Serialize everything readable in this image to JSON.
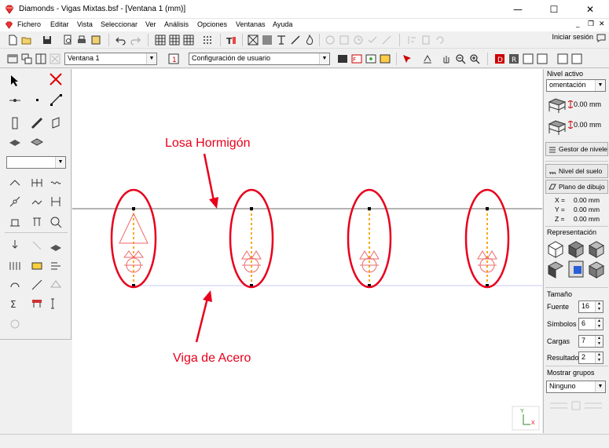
{
  "window": {
    "app_name": "Diamonds",
    "title_rest": "Vigas Mixtas.bsf - [Ventana 1  (mm)]",
    "minimize": "—",
    "maximize": "☐",
    "close": "✕"
  },
  "menu": {
    "items": [
      "Fichero",
      "Editar",
      "Vista",
      "Seleccionar",
      "Ver",
      "Análisis",
      "Opciones",
      "Ventanas",
      "Ayuda"
    ],
    "mdi_min": "_",
    "mdi_restore": "❐",
    "mdi_close": "✕"
  },
  "toolbar": {
    "login_label": "Iniciar sesión",
    "window_combo": "Ventana 1",
    "config_combo": "Configuración de usuario"
  },
  "right_panel": {
    "nivel_activo_label": "Nivel activo",
    "nivel_combo": "omentación",
    "level1_value": "0.00 mm",
    "level2_value": "0.00 mm",
    "gestor_button": "Gestor de niveles",
    "nivel_suelo_button": "Nivel del suelo",
    "plano_dibujo_button": "Plano de dibujo",
    "coords": [
      {
        "axis": "X =",
        "value": "0.00 mm"
      },
      {
        "axis": "Y =",
        "value": "0.00 mm"
      },
      {
        "axis": "Z =",
        "value": "0.00 mm"
      }
    ],
    "representacion_label": "Representación",
    "tamano_label": "Tamaño",
    "fuente_label": "Fuente",
    "fuente_value": "16",
    "simbolos_label": "Símbolos",
    "simbolos_value": "6",
    "cargas_label": "Cargas",
    "cargas_value": "7",
    "resultados_label": "Resultados",
    "resultados_value": "2",
    "mostrar_grupos_label": "Mostrar grupos",
    "grupos_combo": "Ninguno"
  },
  "canvas": {
    "annotation_top": "Losa Hormigón",
    "annotation_bottom": "Viga de Acero",
    "axis_y": "Y",
    "axis_x": "X",
    "annotation_color": "#e8001c",
    "member_color": "#f5a400"
  }
}
